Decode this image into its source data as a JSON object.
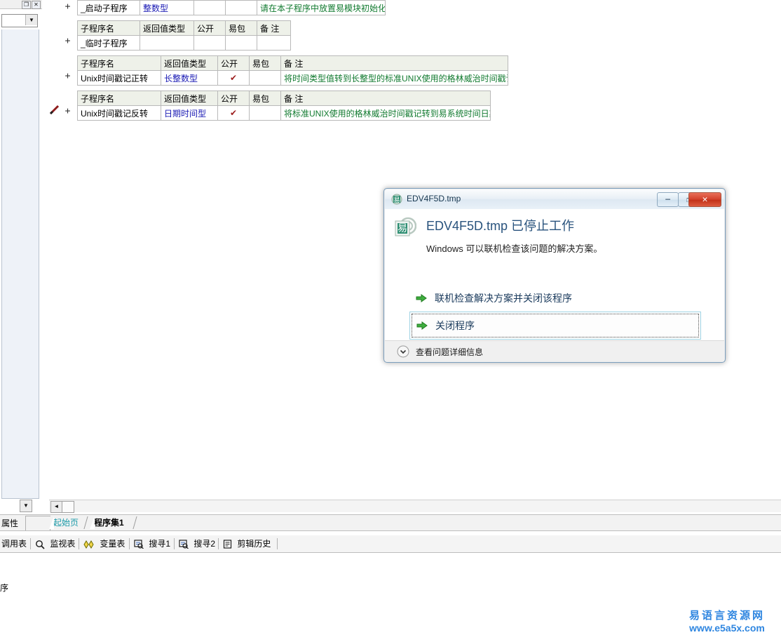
{
  "editor": {
    "tables": [
      {
        "id": "table-startup",
        "show_header": false,
        "headers": [
          "子程序名",
          "返回值类型",
          "公开",
          "易包",
          "备 注"
        ],
        "rows": [
          {
            "name": "_启动子程序",
            "rtype": "整数型",
            "public": "",
            "pack": "",
            "note": "请在本子程序中放置易模块初始化代码"
          }
        ]
      },
      {
        "id": "table-temp",
        "show_header": true,
        "headers": [
          "子程序名",
          "返回值类型",
          "公开",
          "易包",
          "备 注"
        ],
        "rows": [
          {
            "name": "_临时子程序",
            "rtype": "",
            "public": "",
            "pack": "",
            "note": ""
          }
        ]
      },
      {
        "id": "table-unix-forward",
        "show_header": true,
        "headers": [
          "子程序名",
          "返回值类型",
          "公开",
          "易包",
          "备 注"
        ],
        "rows": [
          {
            "name": "Unix时间戳记正转",
            "rtype": "长整数型",
            "public": "✔",
            "pack": "",
            "note": "将时间类型值转到长整型的标准UNIX使用的格林威治时间戳记"
          }
        ]
      },
      {
        "id": "table-unix-reverse",
        "show_header": true,
        "headers": [
          "子程序名",
          "返回值类型",
          "公开",
          "易包",
          "备 注"
        ],
        "rows": [
          {
            "name": "Unix时间戳记反转",
            "rtype": "日期时间型",
            "public": "✔",
            "pack": "",
            "note": "将标准UNIX使用的格林威治时间戳记转到易系统时间日期格式"
          }
        ]
      }
    ],
    "expander_symbol": "+",
    "scroll_left_arrow": "◄",
    "scroll_down_arrow": "▼",
    "combo_arrow": "▼",
    "panel_max_glyph": "❐",
    "panel_close_glyph": "✕"
  },
  "tabstrip": {
    "properties_label": "属性",
    "tabs": [
      {
        "label": "起始页",
        "active": false
      },
      {
        "label": "程序集1",
        "active": true
      }
    ]
  },
  "bottom_toolbar": {
    "items": [
      {
        "label": "调用表",
        "icon": "none"
      },
      {
        "label": "监视表",
        "icon": "magnifier-icon"
      },
      {
        "label": "变量表",
        "icon": "diamonds-icon"
      },
      {
        "label": "搜寻1",
        "icon": "find-icon"
      },
      {
        "label": "搜寻2",
        "icon": "find-icon"
      },
      {
        "label": "剪辑历史",
        "icon": "clipboard-icon"
      }
    ]
  },
  "lower_pane": {
    "clipped_text": "序"
  },
  "dialog": {
    "title": "EDV4F5D.tmp",
    "title_icon": "e-language-icon",
    "heading": "EDV4F5D.tmp 已停止工作",
    "subtitle": "Windows 可以联机检查该问题的解决方案。",
    "app_icon": "e-language-icon",
    "options": [
      {
        "label": "联机检查解决方案并关闭该程序",
        "icon": "green-arrow-icon",
        "focused": false
      },
      {
        "label": "关闭程序",
        "icon": "green-arrow-icon",
        "focused": true
      }
    ],
    "footer": {
      "label": "查看问题详细信息",
      "icon": "chevron-down-circle-icon"
    },
    "window_buttons": {
      "minimize": "─",
      "maximize": "❐",
      "close": "✕"
    }
  },
  "watermark": {
    "cn": "易语言资源网",
    "url": "www.e5a5x.com",
    "color": "#2f86e0"
  },
  "colors": {
    "return_type": "#1a1ab4",
    "note": "#117a2f",
    "check": "#9e2020",
    "tab_active": "#000000",
    "tab_inactive": "#1b9aa8",
    "dialog_heading": "#29537d"
  }
}
